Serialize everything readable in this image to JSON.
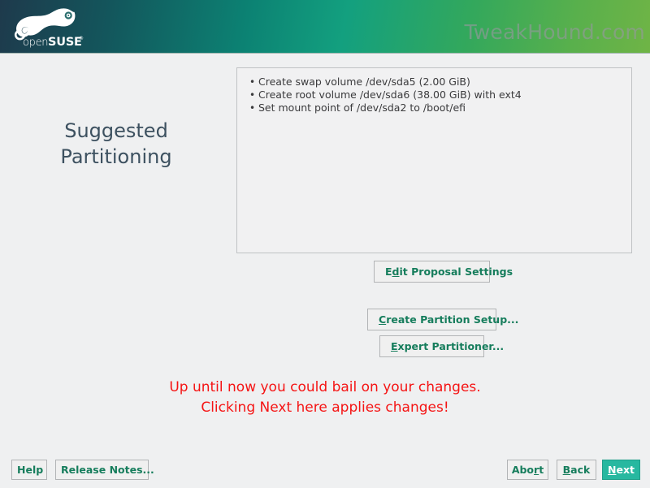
{
  "header": {
    "logo_alt": "openSUSE",
    "logo_text_light": "open",
    "logo_text_bold": "SUSE",
    "watermark": "TweakHound.com",
    "gradient_start": "#1e3a4c",
    "gradient_mid": "#13a07f",
    "gradient_end": "#6fb446"
  },
  "page": {
    "title_line1": "Suggested",
    "title_line2": "Partitioning",
    "title_color": "#3d5160",
    "background": "#eff0f1"
  },
  "proposal": {
    "items": [
      "Create swap volume /dev/sda5 (2.00 GiB)",
      "Create root volume /dev/sda6 (38.00 GiB) with ext4",
      "Set mount point of /dev/sda2 to /boot/efi"
    ]
  },
  "actions": {
    "edit_proposal": {
      "pre": "E",
      "mnemonic": "d",
      "post": "it Proposal Settings"
    },
    "create_partition_setup": {
      "pre": "",
      "mnemonic": "C",
      "post": "reate Partition Setup..."
    },
    "expert_partitioner": {
      "pre": "",
      "mnemonic": "E",
      "post": "xpert Partitioner..."
    }
  },
  "warning": {
    "line1": "Up until now you could bail on your changes.",
    "line2": "Clicking Next here applies changes!",
    "color": "#f51414"
  },
  "footer": {
    "help": {
      "pre": "",
      "mnemonic": "",
      "post": "Help"
    },
    "release_notes": {
      "pre": "",
      "mnemonic": "",
      "post": "Release Notes..."
    },
    "abort": {
      "pre": "Abo",
      "mnemonic": "r",
      "post": "t"
    },
    "back": {
      "pre": "",
      "mnemonic": "B",
      "post": "ack"
    },
    "next": {
      "pre": "",
      "mnemonic": "N",
      "post": "ext"
    },
    "next_color": "#27b8a0",
    "button_text_color": "#167d5c"
  }
}
